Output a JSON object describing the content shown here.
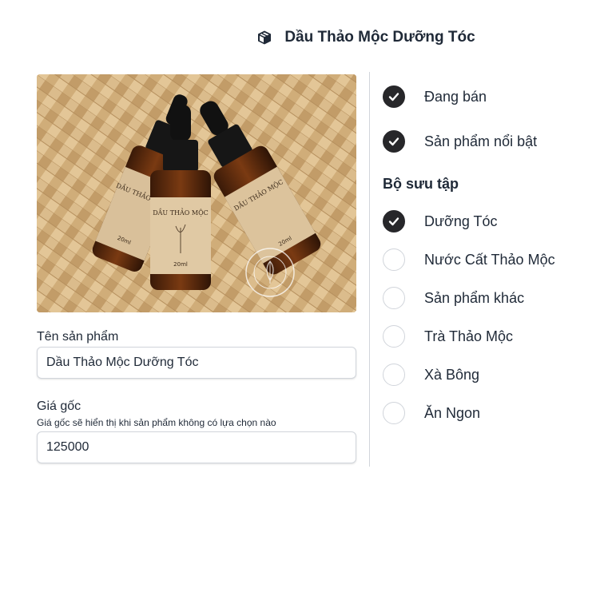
{
  "header": {
    "icon": "package-icon",
    "title": "Dầu Thảo Mộc Dưỡng Tóc"
  },
  "image": {
    "alt": "Dầu Thảo Mộc Dưỡng Tóc",
    "bottle_label": "DẦU THẢO MỘC",
    "volume": "20ml"
  },
  "form": {
    "name_label": "Tên sản phẩm",
    "name_value": "Dầu Thảo Mộc Dưỡng Tóc",
    "price_label": "Giá gốc",
    "price_help": "Giá gốc sẽ hiển thị khi sản phẩm không có lựa chọn nào",
    "price_value": "125000"
  },
  "status": [
    {
      "label": "Đang bán",
      "checked": true
    },
    {
      "label": "Sản phẩm nổi bật",
      "checked": true
    }
  ],
  "collections": {
    "title": "Bộ sưu tập",
    "items": [
      {
        "label": "Dưỡng Tóc",
        "checked": true
      },
      {
        "label": "Nước Cất Thảo Mộc",
        "checked": false
      },
      {
        "label": "Sản phẩm khác",
        "checked": false
      },
      {
        "label": "Trà Thảo Mộc",
        "checked": false
      },
      {
        "label": "Xà Bông",
        "checked": false
      },
      {
        "label": "Ăn Ngon",
        "checked": false
      }
    ]
  },
  "colors": {
    "checked_fill": "#27272a",
    "border": "#d1d5db",
    "text": "#1f2937"
  }
}
